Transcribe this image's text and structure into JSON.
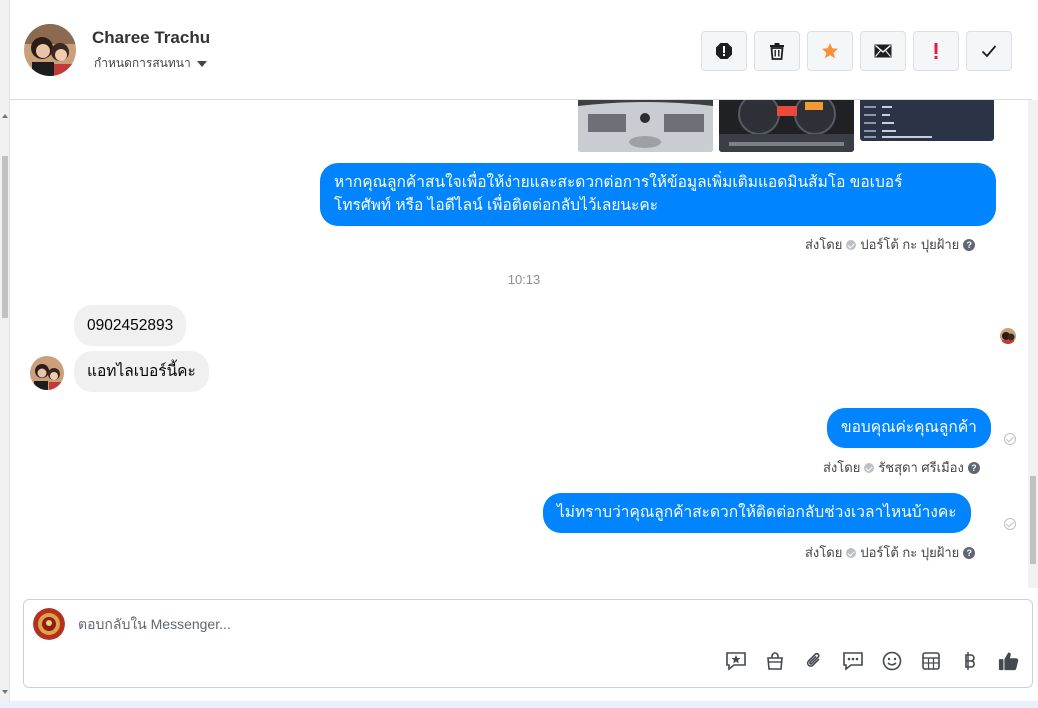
{
  "header": {
    "contact_name": "Charee Trachu",
    "assign_label": "กำหนดการสนทนา",
    "actions": [
      {
        "name": "spam-button",
        "icon": "octagon-exclamation-icon"
      },
      {
        "name": "delete-button",
        "icon": "trash-icon"
      },
      {
        "name": "star-button",
        "icon": "star-icon",
        "color": "#f7923a"
      },
      {
        "name": "mark-unread-button",
        "icon": "envelope-icon"
      },
      {
        "name": "follow-up-button",
        "icon": "exclamation-icon",
        "color": "#e41e3f"
      },
      {
        "name": "done-button",
        "icon": "checkmark-icon"
      }
    ]
  },
  "thread": {
    "messages_out_1": "หากคุณลูกค้าสนใจเพื่อให้ง่ายและสะดวกต่อการให้ข้อมูลเพิ่มเติมแอดมินส้มโอ ขอเบอร์",
    "messages_out_1b": "โทรศัพท์ หรือ ไอดีไลน์ เพื่อติดต่อกลับไว้เลยนะคะ",
    "sent_by_1": "ส่งโดย",
    "sent_by_1_name": "ปอร์โต้ กะ ปุยฝ้าย",
    "timestamp": "10:13",
    "incoming_1": "0902452893",
    "incoming_2": "แอทไลเบอร์นี้คะ",
    "messages_out_2": "ขอบคุณค่ะคุณลูกค้า",
    "sent_by_2": "ส่งโดย",
    "sent_by_2_name": "รัชสุดา ศรีเมือง",
    "messages_out_3": "ไม่ทราบว่าคุณลูกค้าสะดวกให้ติดต่อกลับช่วงเวลาไหนบ้างคะ",
    "sent_by_3": "ส่งโดย",
    "sent_by_3_name": "ปอร์โต้ กะ ปุยฝ้าย"
  },
  "composer": {
    "placeholder": "ตอบกลับใน Messenger...",
    "tools": [
      "saved-reply-icon",
      "shopping-bag-icon",
      "paperclip-icon",
      "chat-bubble-icon",
      "smiley-icon",
      "table-icon",
      "baht-icon",
      "thumbs-up-icon"
    ]
  },
  "colors": {
    "outgoing_bubble": "#0084ff",
    "incoming_bubble": "#f0f0f0"
  }
}
